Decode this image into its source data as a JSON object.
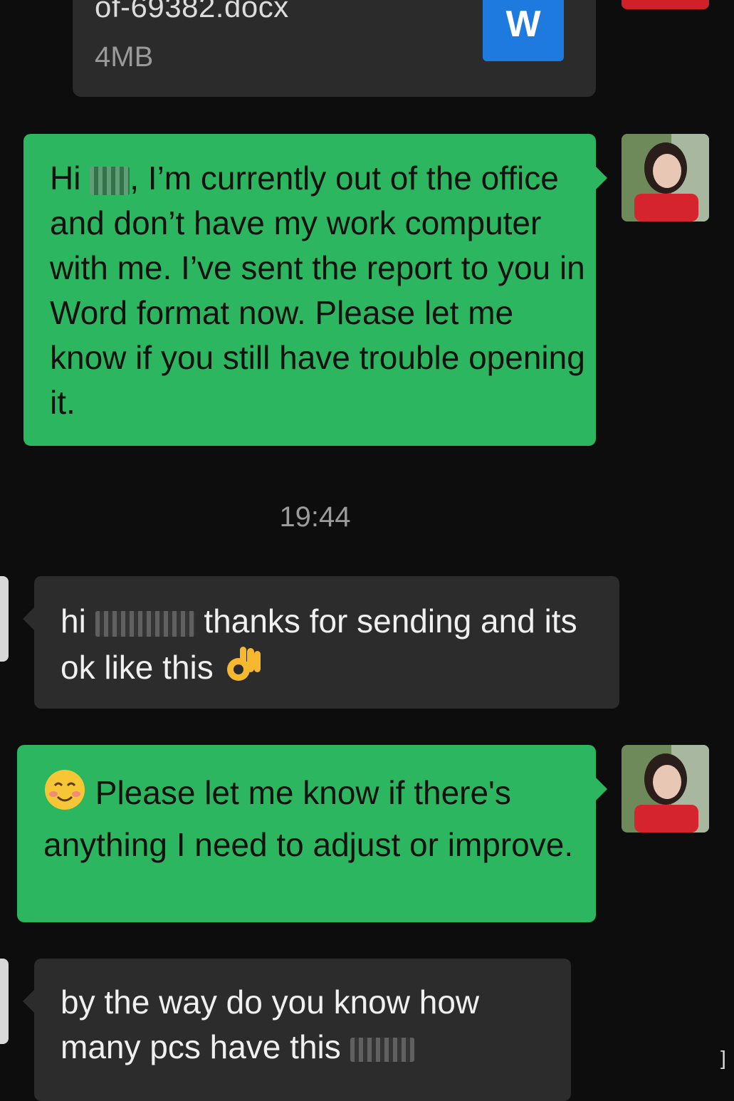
{
  "file_message": {
    "file_name": "of-69382.docx",
    "file_size": "4MB",
    "icon_letter": "W",
    "icon_color": "#1f7ae0"
  },
  "messages": [
    {
      "side": "outgoing",
      "text_before_redaction": "Hi ",
      "text_after_redaction": ", I’m currently out of the office and don’t have my work computer with me. I’ve sent the report to you in Word format now. Please let me know if you still have trouble opening it."
    },
    {
      "side": "incoming",
      "text_before_redaction": "hi ",
      "text_after_redaction": " thanks for sending and its ok like this",
      "emoji": "ok-hand-emoji"
    },
    {
      "side": "outgoing",
      "emoji": "smiling-face-emoji",
      "text": " Please let me know if there's anything I need to adjust or improve."
    },
    {
      "side": "incoming",
      "text": " by the way do you know how many pcs have this"
    }
  ],
  "timestamp": "19:44",
  "colors": {
    "background": "#0d0d0d",
    "outgoing_bubble": "#2cb65f",
    "incoming_bubble": "#2c2c2c",
    "timestamp_text": "#9b9b9b"
  }
}
